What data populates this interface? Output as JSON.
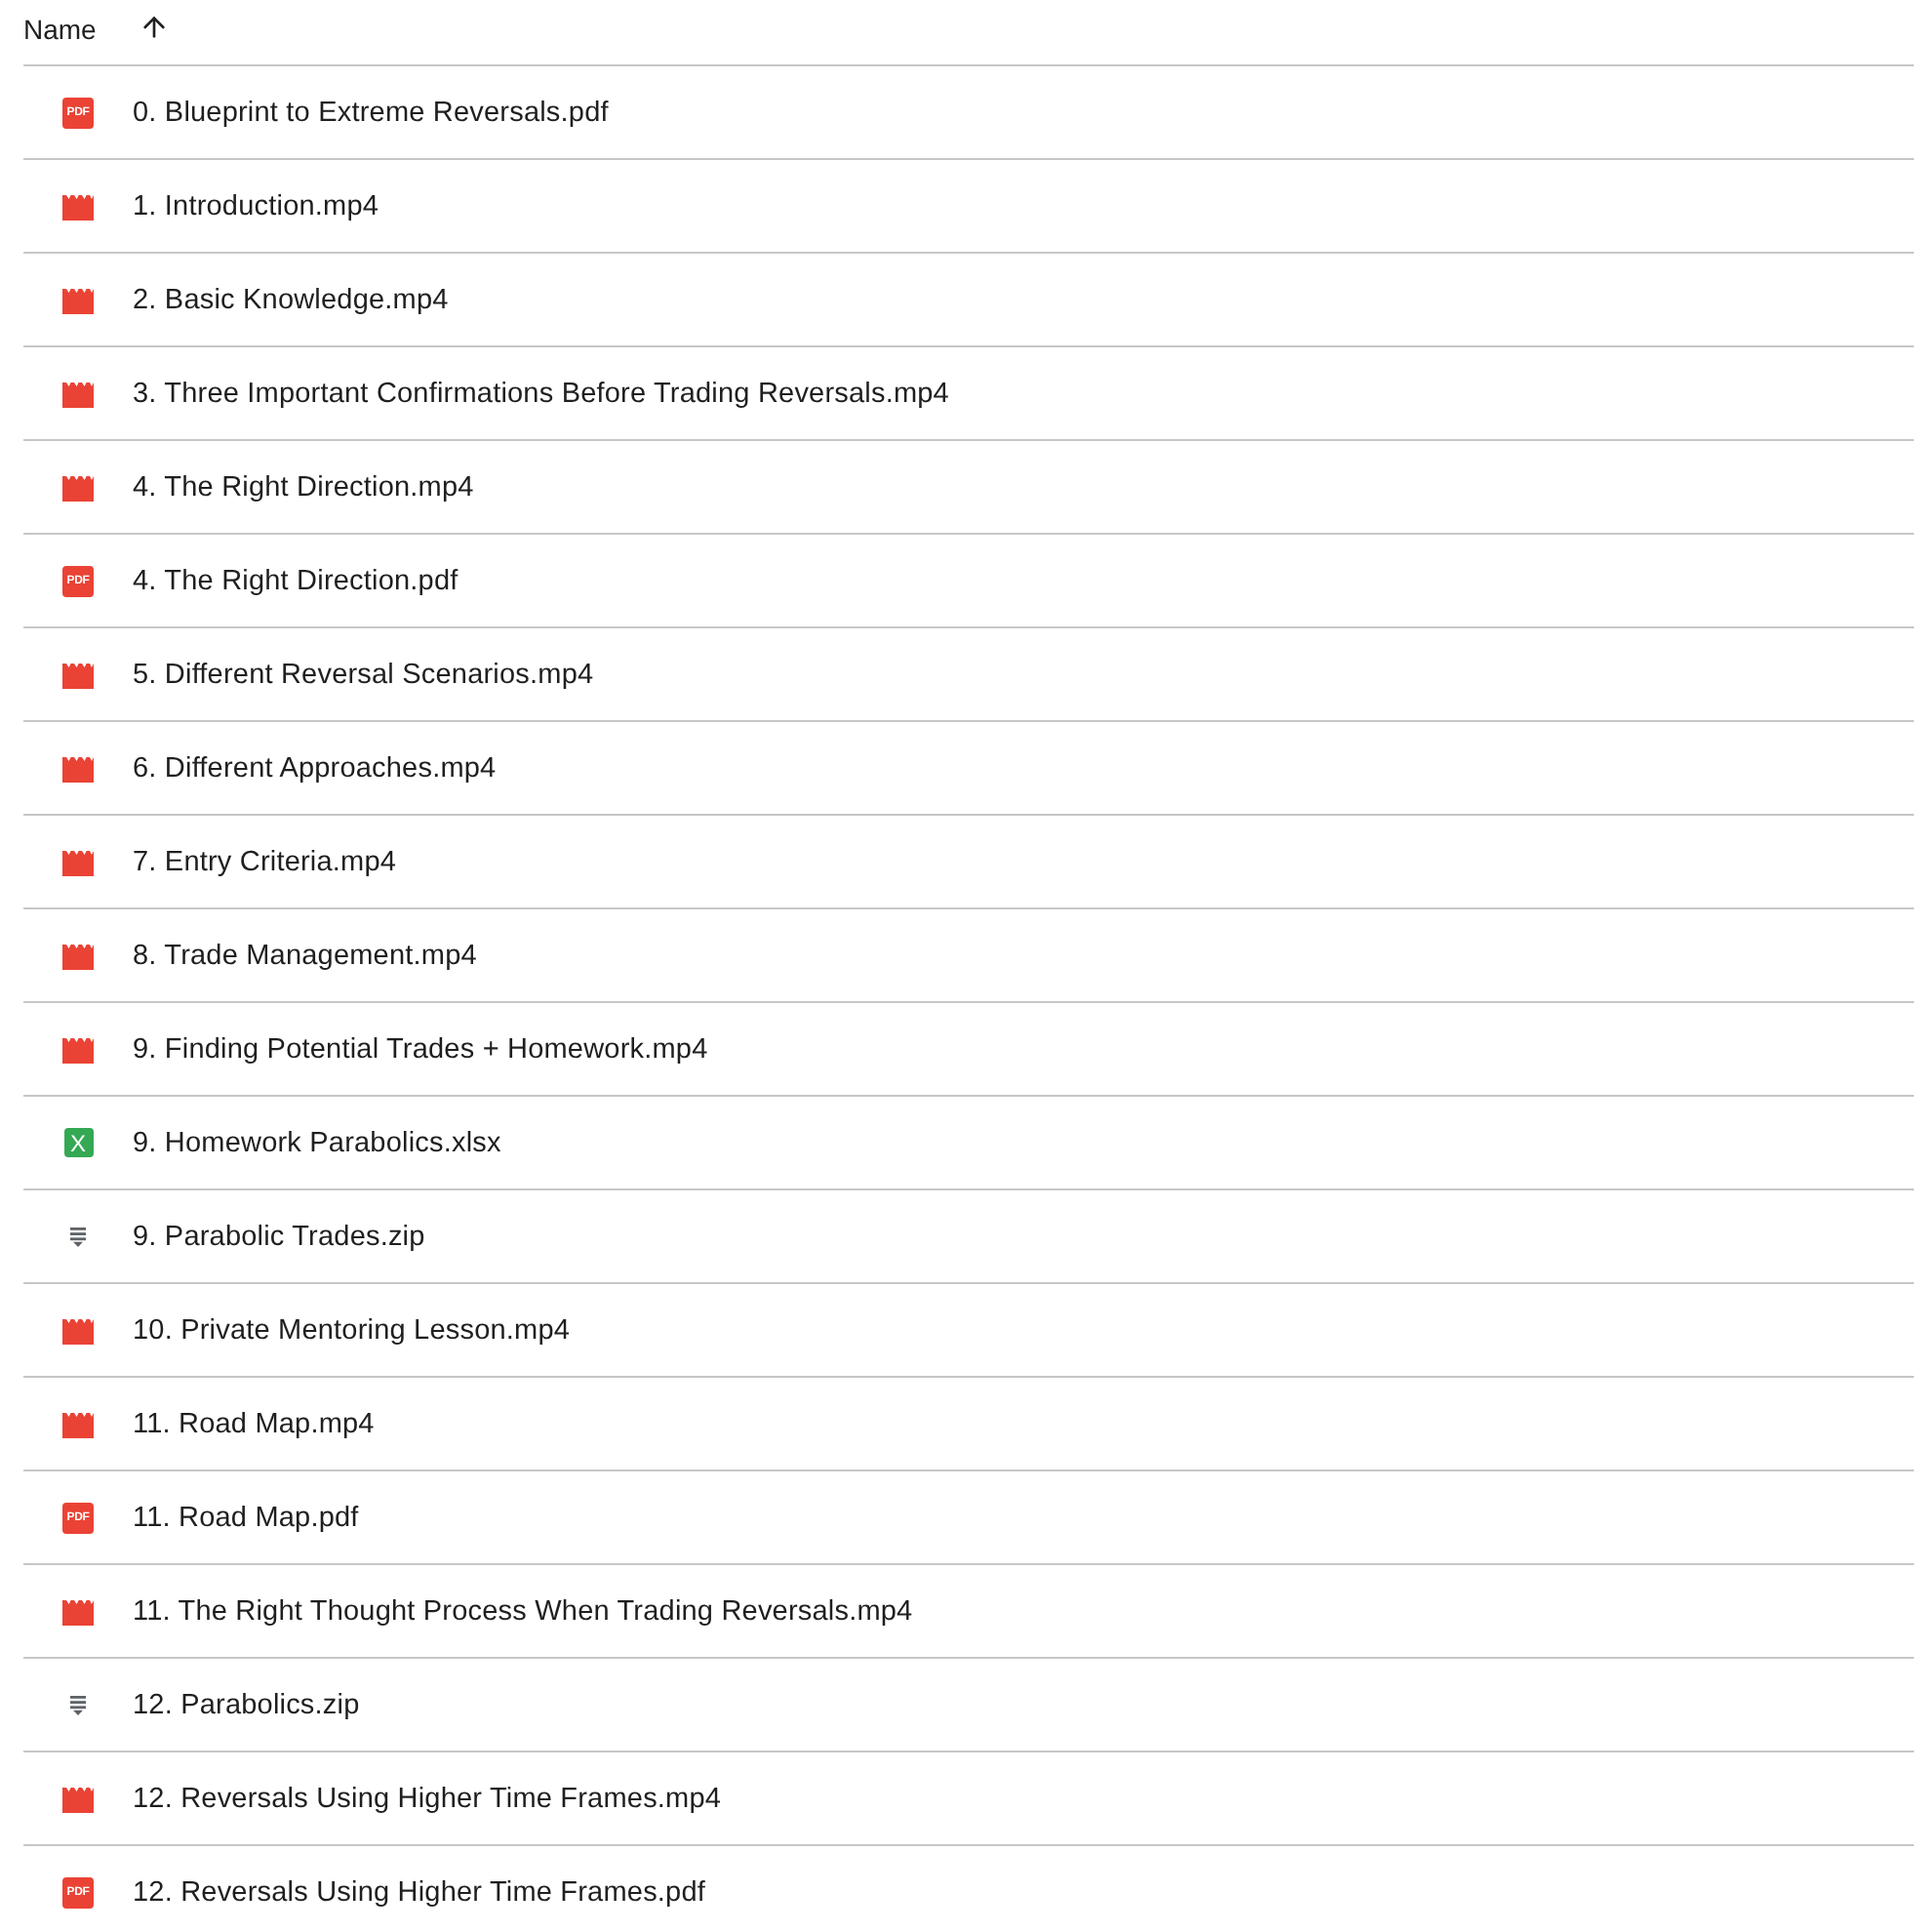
{
  "header": {
    "label": "Name",
    "sort_ascending": true
  },
  "files": [
    {
      "name": "0. Blueprint to Extreme Reversals.pdf",
      "kind": "pdf",
      "icon_text": "PDF"
    },
    {
      "name": "1. Introduction.mp4",
      "kind": "video"
    },
    {
      "name": "2. Basic Knowledge.mp4",
      "kind": "video"
    },
    {
      "name": "3. Three Important Confirmations Before Trading Reversals.mp4",
      "kind": "video"
    },
    {
      "name": "4. The Right Direction.mp4",
      "kind": "video"
    },
    {
      "name": "4. The Right Direction.pdf",
      "kind": "pdf",
      "icon_text": "PDF"
    },
    {
      "name": "5. Different Reversal Scenarios.mp4",
      "kind": "video"
    },
    {
      "name": "6. Different Approaches.mp4",
      "kind": "video"
    },
    {
      "name": "7. Entry Criteria.mp4",
      "kind": "video"
    },
    {
      "name": "8. Trade Management.mp4",
      "kind": "video"
    },
    {
      "name": "9. Finding Potential Trades + Homework.mp4",
      "kind": "video"
    },
    {
      "name": "9. Homework Parabolics.xlsx",
      "kind": "sheet",
      "icon_text": "X"
    },
    {
      "name": "9. Parabolic Trades.zip",
      "kind": "archive"
    },
    {
      "name": "10. Private Mentoring Lesson.mp4",
      "kind": "video"
    },
    {
      "name": "11. Road Map.mp4",
      "kind": "video"
    },
    {
      "name": "11. Road Map.pdf",
      "kind": "pdf",
      "icon_text": "PDF"
    },
    {
      "name": "11. The Right Thought Process When Trading Reversals.mp4",
      "kind": "video"
    },
    {
      "name": "12. Parabolics.zip",
      "kind": "archive"
    },
    {
      "name": "12. Reversals Using Higher Time Frames.mp4",
      "kind": "video"
    },
    {
      "name": "12. Reversals Using Higher Time Frames.pdf",
      "kind": "pdf",
      "icon_text": "PDF"
    }
  ]
}
